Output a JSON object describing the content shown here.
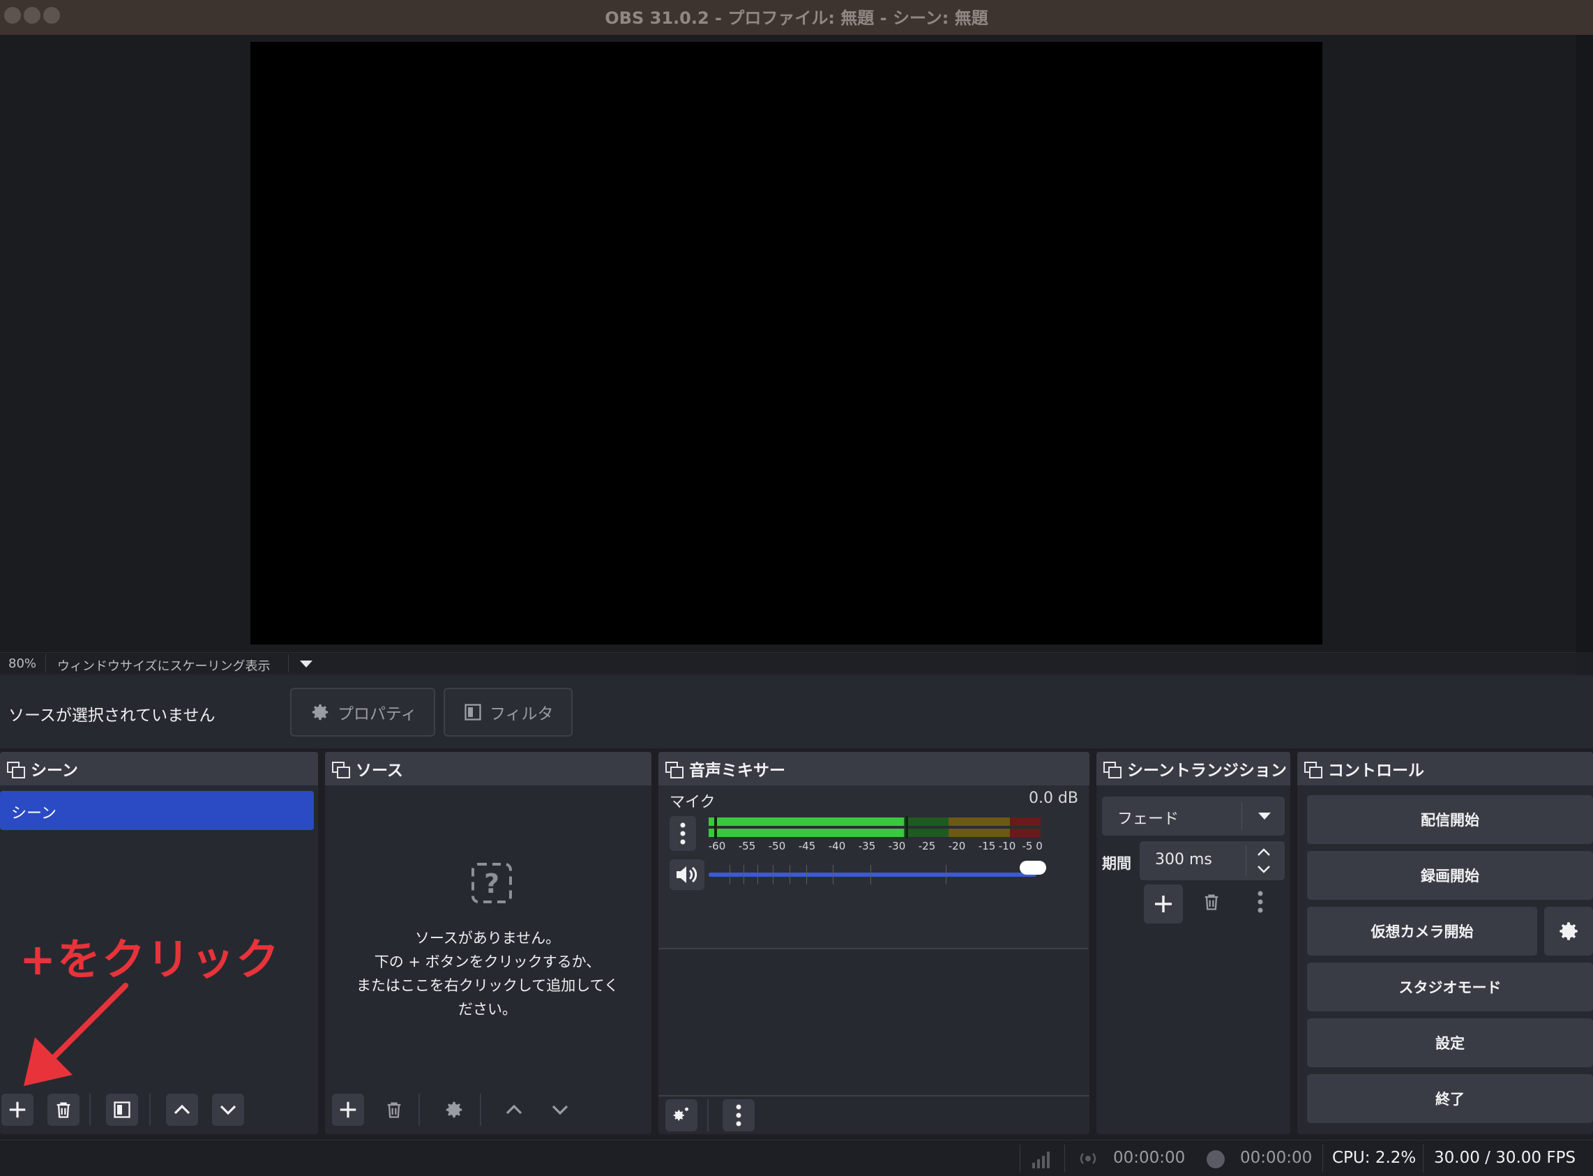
{
  "window": {
    "title": "OBS 31.0.2 - プロファイル: 無題 - シーン: 無題"
  },
  "preview": {
    "zoom": "80%",
    "scale_mode": "ウィンドウサイズにスケーリング表示"
  },
  "context": {
    "no_source": "ソースが選択されていません",
    "properties": "プロパティ",
    "filters": "フィルタ"
  },
  "docks": {
    "scenes": {
      "title": "シーン",
      "items": [
        "シーン"
      ]
    },
    "sources": {
      "title": "ソース",
      "empty_lines": [
        "ソースがありません。",
        "下の + ボタンをクリックするか、",
        "またはここを右クリックして追加してく",
        "ださい。"
      ]
    },
    "mixer": {
      "title": "音声ミキサー",
      "channel": "マイク",
      "level": "0.0 dB",
      "ticks": [
        "-60",
        "-55",
        "-50",
        "-45",
        "-40",
        "-35",
        "-30",
        "-25",
        "-20",
        "-15",
        "-10",
        "-5",
        "0"
      ],
      "volume": 1.0
    },
    "transitions": {
      "title": "シーントランジション",
      "type": "フェード",
      "duration_label": "期間",
      "duration": "300 ms"
    },
    "controls": {
      "title": "コントロール",
      "buttons": [
        "配信開始",
        "録画開始",
        "仮想カメラ開始",
        "スタジオモード",
        "設定",
        "終了"
      ]
    }
  },
  "status": {
    "stream_time": "00:00:00",
    "rec_time": "00:00:00",
    "cpu": "CPU: 2.2%",
    "fps": "30.00 / 30.00 FPS"
  },
  "annotation": {
    "text": "+をクリック"
  },
  "colors": {
    "accent": "#2b4bc4",
    "annotation": "#e8333a",
    "meter_green": "#3ac83f",
    "meter_yellow": "#c8a62b",
    "meter_red": "#c83030"
  }
}
